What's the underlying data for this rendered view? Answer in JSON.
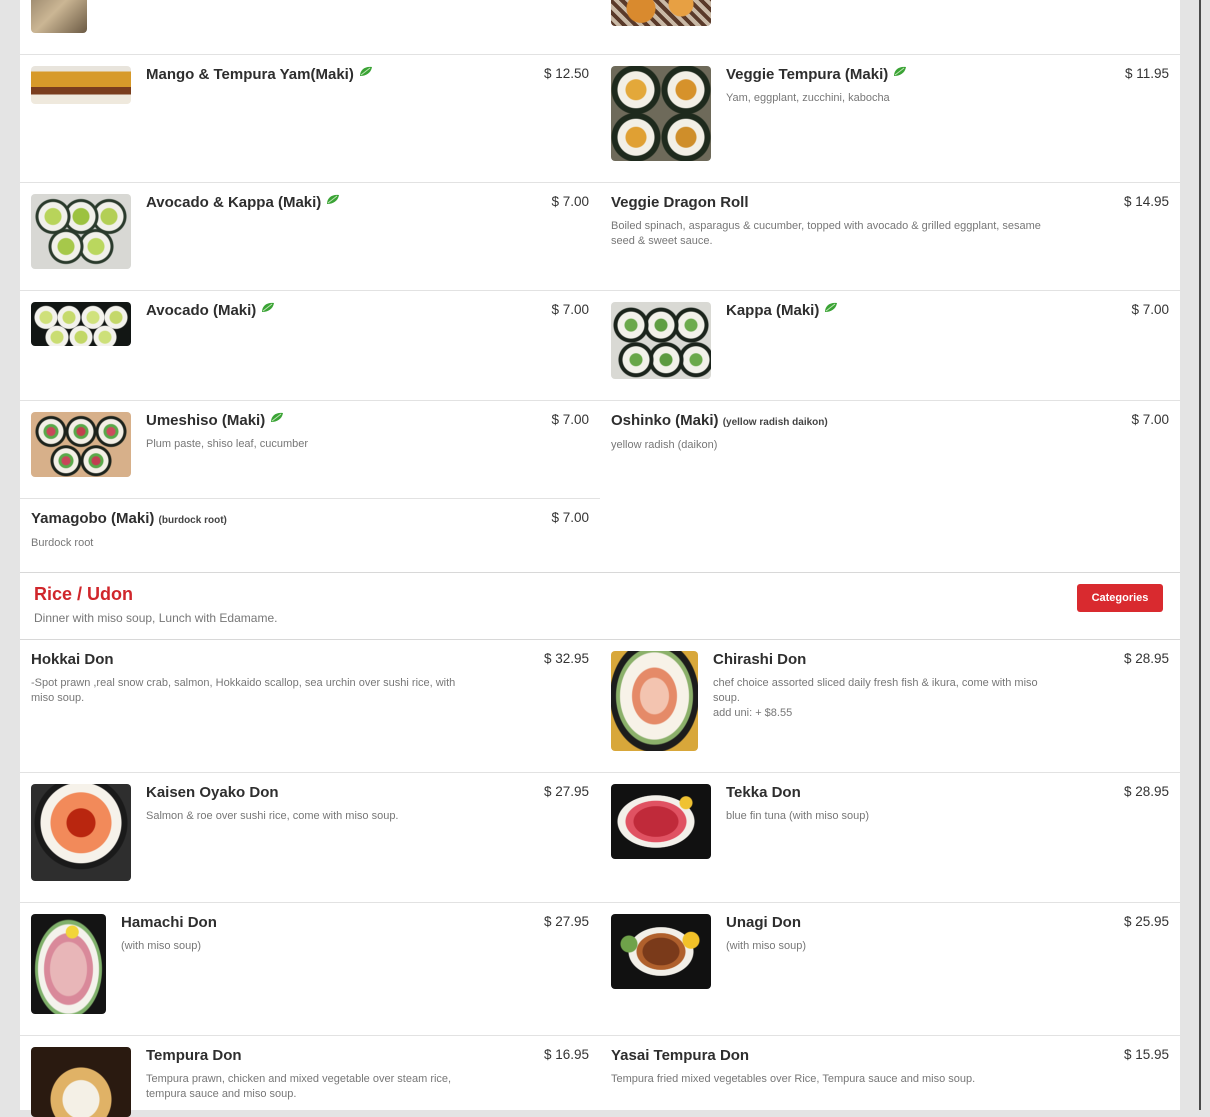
{
  "colors": {
    "accent": "#d92a2f",
    "veg_leaf": "#3aa335"
  },
  "top_partial": [
    {
      "thumb": "top-left-food-photo-icon"
    },
    {
      "thumb": "top-right-food-photo-icon"
    }
  ],
  "items": {
    "mango": {
      "name": "Mango & Tempura Yam(Maki)",
      "price": "$ 12.50",
      "veg": true
    },
    "veggie_tempura": {
      "name": "Veggie Tempura (Maki)",
      "desc": "Yam, eggplant, zucchini, kabocha",
      "price": "$ 11.95",
      "veg": true
    },
    "avo_kappa": {
      "name": "Avocado & Kappa (Maki)",
      "price": "$ 7.00",
      "veg": true
    },
    "veggie_dragon": {
      "name": "Veggie Dragon Roll",
      "desc": "Boiled spinach, asparagus & cucumber, topped with avocado & grilled eggplant, sesame seed & sweet sauce.",
      "price": "$ 14.95"
    },
    "avocado": {
      "name": "Avocado (Maki)",
      "price": "$ 7.00",
      "veg": true
    },
    "kappa": {
      "name": "Kappa (Maki)",
      "price": "$ 7.00",
      "veg": true
    },
    "umeshiso": {
      "name": "Umeshiso (Maki)",
      "desc": "Plum paste, shiso leaf, cucumber",
      "price": "$ 7.00",
      "veg": true
    },
    "oshinko": {
      "name": "Oshinko (Maki)",
      "note": "(yellow radish daikon)",
      "desc": "yellow radish (daikon)",
      "price": "$ 7.00"
    },
    "yamagobo": {
      "name": "Yamagobo (Maki)",
      "note": "(burdock root)",
      "desc": "Burdock root",
      "price": "$ 7.00"
    },
    "hokkai": {
      "name": "Hokkai Don",
      "desc": "-Spot prawn ,real snow crab, salmon, Hokkaido scallop, sea urchin over sushi rice, with miso soup.",
      "price": "$ 32.95"
    },
    "chirashi": {
      "name": "Chirashi Don",
      "desc": "chef choice assorted sliced daily fresh fish & ikura, come with miso soup.",
      "desc2": "add uni: + $8.55",
      "price": "$ 28.95"
    },
    "kaisen": {
      "name": "Kaisen Oyako Don",
      "desc": "Salmon & roe over sushi rice, come with miso soup.",
      "price": "$ 27.95"
    },
    "tekka": {
      "name": "Tekka Don",
      "desc": "blue fin tuna (with miso soup)",
      "price": "$ 28.95"
    },
    "hamachi": {
      "name": "Hamachi Don",
      "desc": "(with miso soup)",
      "price": "$ 27.95"
    },
    "unagi": {
      "name": "Unagi Don",
      "desc": "(with miso soup)",
      "price": "$ 25.95"
    },
    "tempura_don": {
      "name": "Tempura Don",
      "desc": "Tempura prawn, chicken and mixed vegetable over steam rice, tempura sauce and miso soup.",
      "price": "$ 16.95"
    },
    "yasai": {
      "name": "Yasai Tempura Don",
      "desc": "Tempura fried mixed vegetables over Rice, Tempura sauce and miso soup.",
      "price": "$ 15.95"
    }
  },
  "category": {
    "title": "Rice / Udon",
    "subtitle": "Dinner with miso soup, Lunch with Edamame.",
    "button_label": "Categories"
  }
}
